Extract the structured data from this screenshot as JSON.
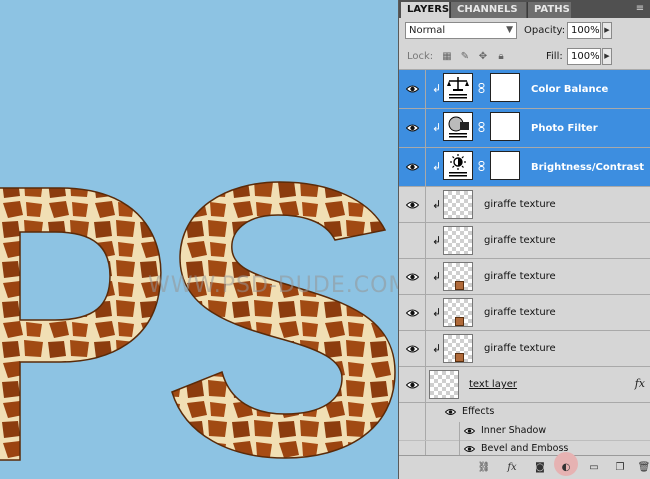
{
  "canvas": {
    "watermark": "WWW.PSD-DUDE.COM/TUTORIALS/",
    "background_color": "#8dc3e3"
  },
  "panel": {
    "tabs": [
      {
        "label": "LAYERS",
        "active": true
      },
      {
        "label": "CHANNELS",
        "active": false
      },
      {
        "label": "PATHS",
        "active": false
      }
    ],
    "blend_mode": "Normal",
    "opacity_label": "Opacity:",
    "opacity_value": "100%",
    "lock_label": "Lock:",
    "fill_label": "Fill:",
    "fill_value": "100%",
    "selection_color": "#3d8ee0",
    "layers": [
      {
        "name": "Color Balance",
        "type": "adjustment",
        "icon": "color-balance-icon",
        "selected": true
      },
      {
        "name": "Photo Filter",
        "type": "adjustment",
        "icon": "photo-filter-icon",
        "selected": true
      },
      {
        "name": "Brightness/Contrast",
        "type": "adjustment",
        "icon": "brightness-contrast-icon",
        "selected": true
      },
      {
        "name": "giraffe texture",
        "type": "texture",
        "selected": false
      },
      {
        "name": "giraffe texture",
        "type": "texture",
        "selected": false
      },
      {
        "name": "giraffe texture",
        "type": "texture",
        "selected": false
      },
      {
        "name": "giraffe texture",
        "type": "texture",
        "selected": false
      },
      {
        "name": "giraffe texture",
        "type": "texture",
        "selected": false
      },
      {
        "name": "text layer",
        "type": "text",
        "fx": "fx",
        "selected": false
      }
    ],
    "effects": {
      "label": "Effects",
      "items": [
        "Inner Shadow",
        "Bevel and Emboss"
      ]
    },
    "bottom_icons": [
      "link-layers-icon",
      "fx-icon",
      "add-mask-icon",
      "adjustment-layer-icon",
      "new-group-icon",
      "new-layer-icon",
      "trash-icon"
    ]
  }
}
